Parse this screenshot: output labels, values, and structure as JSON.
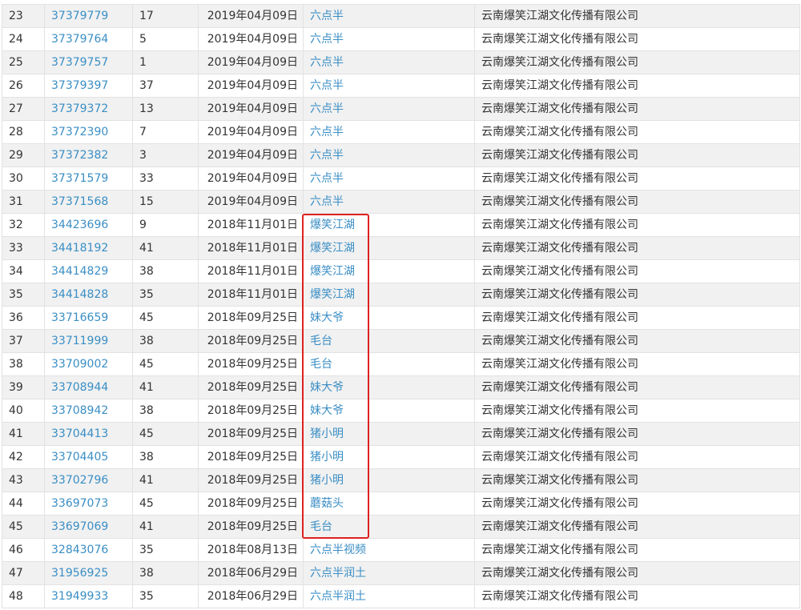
{
  "rows": [
    {
      "idx": "23",
      "reg": "37379779",
      "cls": "17",
      "date": "2019年04月09日",
      "name": "六点半",
      "applicant": "云南爆笑江湖文化传播有限公司"
    },
    {
      "idx": "24",
      "reg": "37379764",
      "cls": "5",
      "date": "2019年04月09日",
      "name": "六点半",
      "applicant": "云南爆笑江湖文化传播有限公司"
    },
    {
      "idx": "25",
      "reg": "37379757",
      "cls": "1",
      "date": "2019年04月09日",
      "name": "六点半",
      "applicant": "云南爆笑江湖文化传播有限公司"
    },
    {
      "idx": "26",
      "reg": "37379397",
      "cls": "37",
      "date": "2019年04月09日",
      "name": "六点半",
      "applicant": "云南爆笑江湖文化传播有限公司"
    },
    {
      "idx": "27",
      "reg": "37379372",
      "cls": "13",
      "date": "2019年04月09日",
      "name": "六点半",
      "applicant": "云南爆笑江湖文化传播有限公司"
    },
    {
      "idx": "28",
      "reg": "37372390",
      "cls": "7",
      "date": "2019年04月09日",
      "name": "六点半",
      "applicant": "云南爆笑江湖文化传播有限公司"
    },
    {
      "idx": "29",
      "reg": "37372382",
      "cls": "3",
      "date": "2019年04月09日",
      "name": "六点半",
      "applicant": "云南爆笑江湖文化传播有限公司"
    },
    {
      "idx": "30",
      "reg": "37371579",
      "cls": "33",
      "date": "2019年04月09日",
      "name": "六点半",
      "applicant": "云南爆笑江湖文化传播有限公司"
    },
    {
      "idx": "31",
      "reg": "37371568",
      "cls": "15",
      "date": "2019年04月09日",
      "name": "六点半",
      "applicant": "云南爆笑江湖文化传播有限公司"
    },
    {
      "idx": "32",
      "reg": "34423696",
      "cls": "9",
      "date": "2018年11月01日",
      "name": "爆笑江湖",
      "applicant": "云南爆笑江湖文化传播有限公司"
    },
    {
      "idx": "33",
      "reg": "34418192",
      "cls": "41",
      "date": "2018年11月01日",
      "name": "爆笑江湖",
      "applicant": "云南爆笑江湖文化传播有限公司"
    },
    {
      "idx": "34",
      "reg": "34414829",
      "cls": "38",
      "date": "2018年11月01日",
      "name": "爆笑江湖",
      "applicant": "云南爆笑江湖文化传播有限公司"
    },
    {
      "idx": "35",
      "reg": "34414828",
      "cls": "35",
      "date": "2018年11月01日",
      "name": "爆笑江湖",
      "applicant": "云南爆笑江湖文化传播有限公司"
    },
    {
      "idx": "36",
      "reg": "33716659",
      "cls": "45",
      "date": "2018年09月25日",
      "name": "妹大爷",
      "applicant": "云南爆笑江湖文化传播有限公司"
    },
    {
      "idx": "37",
      "reg": "33711999",
      "cls": "38",
      "date": "2018年09月25日",
      "name": "毛台",
      "applicant": "云南爆笑江湖文化传播有限公司"
    },
    {
      "idx": "38",
      "reg": "33709002",
      "cls": "45",
      "date": "2018年09月25日",
      "name": "毛台",
      "applicant": "云南爆笑江湖文化传播有限公司"
    },
    {
      "idx": "39",
      "reg": "33708944",
      "cls": "41",
      "date": "2018年09月25日",
      "name": "妹大爷",
      "applicant": "云南爆笑江湖文化传播有限公司"
    },
    {
      "idx": "40",
      "reg": "33708942",
      "cls": "38",
      "date": "2018年09月25日",
      "name": "妹大爷",
      "applicant": "云南爆笑江湖文化传播有限公司"
    },
    {
      "idx": "41",
      "reg": "33704413",
      "cls": "45",
      "date": "2018年09月25日",
      "name": "猪小明",
      "applicant": "云南爆笑江湖文化传播有限公司"
    },
    {
      "idx": "42",
      "reg": "33704405",
      "cls": "38",
      "date": "2018年09月25日",
      "name": "猪小明",
      "applicant": "云南爆笑江湖文化传播有限公司"
    },
    {
      "idx": "43",
      "reg": "33702796",
      "cls": "41",
      "date": "2018年09月25日",
      "name": "猪小明",
      "applicant": "云南爆笑江湖文化传播有限公司"
    },
    {
      "idx": "44",
      "reg": "33697073",
      "cls": "45",
      "date": "2018年09月25日",
      "name": "蘑菇头",
      "applicant": "云南爆笑江湖文化传播有限公司"
    },
    {
      "idx": "45",
      "reg": "33697069",
      "cls": "41",
      "date": "2018年09月25日",
      "name": "毛台",
      "applicant": "云南爆笑江湖文化传播有限公司"
    },
    {
      "idx": "46",
      "reg": "32843076",
      "cls": "35",
      "date": "2018年08月13日",
      "name": "六点半视频",
      "applicant": "云南爆笑江湖文化传播有限公司"
    },
    {
      "idx": "47",
      "reg": "31956925",
      "cls": "38",
      "date": "2018年06月29日",
      "name": "六点半润土",
      "applicant": "云南爆笑江湖文化传播有限公司"
    },
    {
      "idx": "48",
      "reg": "31949933",
      "cls": "35",
      "date": "2018年06月29日",
      "name": "六点半润土",
      "applicant": "云南爆笑江湖文化传播有限公司"
    }
  ],
  "highlight": {
    "color": "#e02020",
    "rows": [
      "32",
      "45"
    ]
  },
  "colors": {
    "link": "#3a8ec5",
    "row_stripe": "#f1f1f1",
    "border": "#e2e2e2"
  }
}
